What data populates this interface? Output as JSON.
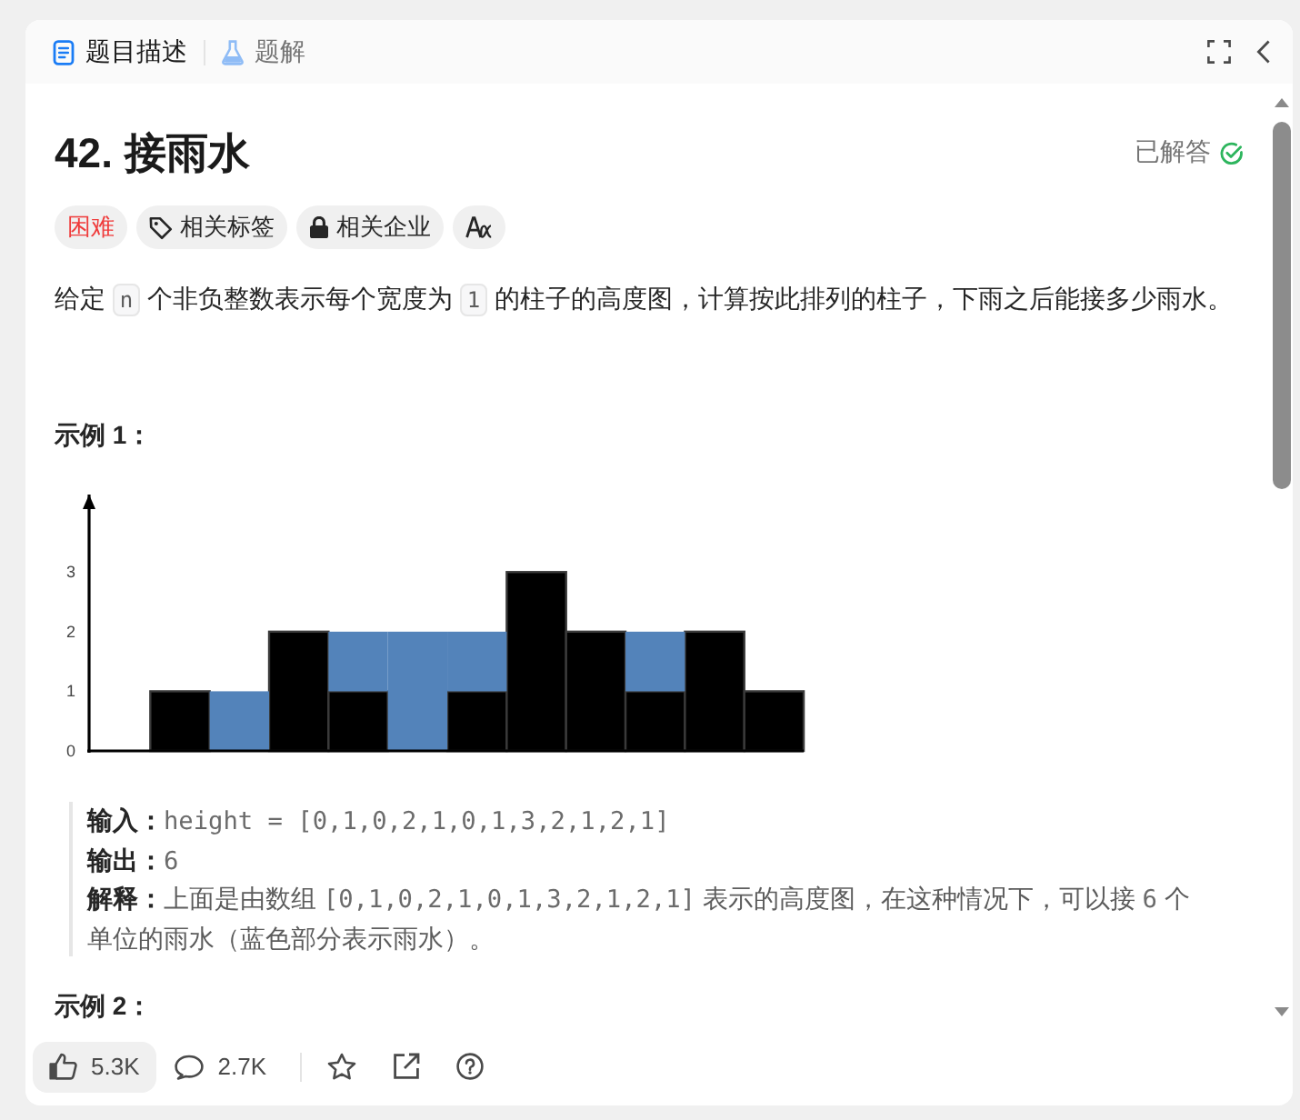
{
  "tabs": [
    {
      "kind": "description",
      "label": "题目描述",
      "selected": true
    },
    {
      "kind": "solutions",
      "label": "题解",
      "selected": false
    }
  ],
  "problem": {
    "title": "42. 接雨水",
    "status": "已解答",
    "solved": true,
    "tags": [
      {
        "kind": "difficulty",
        "label": "困难"
      },
      {
        "kind": "topics",
        "label": "相关标签"
      },
      {
        "kind": "companies",
        "label": "相关企业"
      },
      {
        "kind": "translate"
      }
    ],
    "description": [
      {
        "kind": "text",
        "text": "给定 "
      },
      {
        "kind": "code",
        "text": "n"
      },
      {
        "kind": "text",
        "text": " 个非负整数表示每个宽度为 "
      },
      {
        "kind": "code",
        "text": "1"
      },
      {
        "kind": "text",
        "text": " 的柱子的高度图，计算按此排列的柱子，下雨之后能接多少雨水。"
      }
    ],
    "examples": [
      {
        "heading": "示例 1：",
        "chart_data": {
          "type": "bar",
          "stacked": true,
          "ylim": [
            0,
            4.3
          ],
          "yticks": [
            0,
            1,
            2,
            3
          ],
          "series": [
            {
              "color": "#000000",
              "values": [
                0,
                1,
                0,
                2,
                1,
                0,
                1,
                3,
                2,
                1,
                2,
                1
              ]
            },
            {
              "color": "#5383ba",
              "values": [
                0,
                0,
                1,
                0,
                1,
                2,
                1,
                0,
                0,
                1,
                0,
                0
              ]
            }
          ]
        },
        "lines": [
          {
            "label": "输入：",
            "parts": [
              {
                "kind": "code",
                "text": "height = [0,1,0,2,1,0,1,3,2,1,2,1]"
              }
            ]
          },
          {
            "label": "输出：",
            "parts": [
              {
                "kind": "code",
                "text": "6"
              }
            ]
          },
          {
            "label": "解释：",
            "parts": [
              {
                "kind": "text",
                "text": "上面是由数组 "
              },
              {
                "kind": "code",
                "text": "[0,1,0,2,1,0,1,3,2,1,2,1]"
              },
              {
                "kind": "text",
                "text": " 表示的高度图，在这种情况下，可以接 "
              },
              {
                "kind": "code",
                "text": "6"
              },
              {
                "kind": "text",
                "text": " 个单位的雨水（蓝色部分表示雨水）。"
              }
            ]
          }
        ]
      },
      {
        "heading": "示例 2："
      }
    ]
  },
  "actions": [
    {
      "kind": "like",
      "count": "5.3K"
    },
    {
      "kind": "comment",
      "count": "2.7K"
    },
    {
      "kind": "divider"
    },
    {
      "kind": "favorite"
    },
    {
      "kind": "share"
    },
    {
      "kind": "help"
    }
  ]
}
